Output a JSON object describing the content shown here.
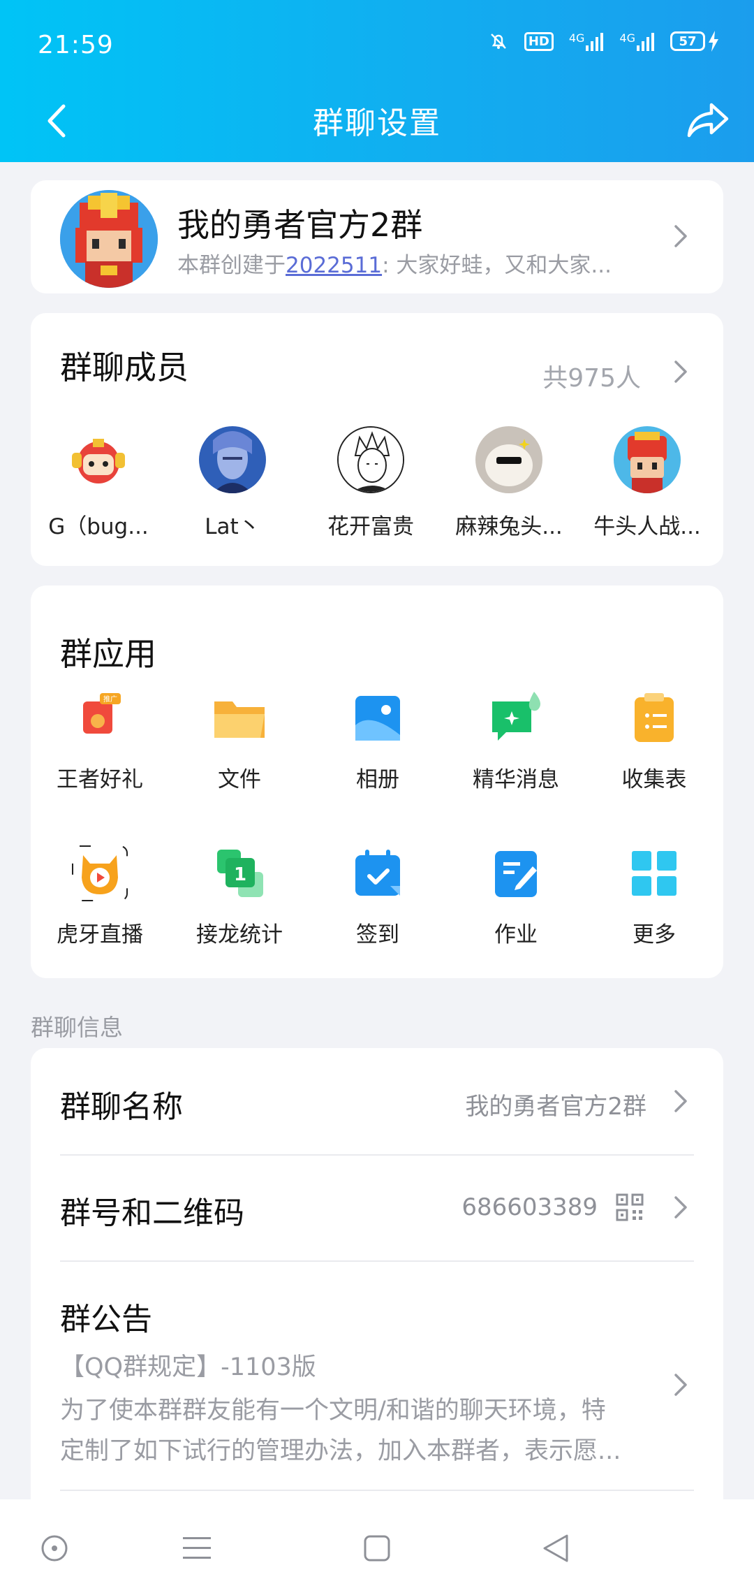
{
  "status_bar": {
    "time": "21:59",
    "hd_label": "HD",
    "net1": "4G",
    "net2": "4G",
    "battery": "57"
  },
  "nav": {
    "title": "群聊设置",
    "back_icon": "back-chevron-icon",
    "share_icon": "share-icon"
  },
  "group": {
    "name": "我的勇者官方2群",
    "desc_prefix": "本群创建于",
    "desc_link": "2022511",
    "desc_suffix": ": 大家好蛙，又和大家..."
  },
  "members": {
    "title": "群聊成员",
    "count": "共975人",
    "list": [
      {
        "name": "G（bug..."
      },
      {
        "name": "Lat丶"
      },
      {
        "name": "花开富贵"
      },
      {
        "name": "麻辣兔头..."
      },
      {
        "name": "牛头人战..."
      }
    ]
  },
  "apps": {
    "title": "群应用",
    "items": [
      {
        "label": "王者好礼",
        "icon": "gift-icon"
      },
      {
        "label": "文件",
        "icon": "folder-icon"
      },
      {
        "label": "相册",
        "icon": "album-icon"
      },
      {
        "label": "精华消息",
        "icon": "essence-message-icon"
      },
      {
        "label": "收集表",
        "icon": "form-icon"
      },
      {
        "label": "虎牙直播",
        "icon": "huya-live-icon"
      },
      {
        "label": "接龙统计",
        "icon": "relay-stats-icon"
      },
      {
        "label": "签到",
        "icon": "checkin-icon"
      },
      {
        "label": "作业",
        "icon": "homework-icon"
      },
      {
        "label": "更多",
        "icon": "more-grid-icon"
      }
    ],
    "gift_badge": "推广"
  },
  "info": {
    "section_label": "群聊信息",
    "name_row": {
      "title": "群聊名称",
      "value": "我的勇者官方2群"
    },
    "id_row": {
      "title": "群号和二维码",
      "value": "686603389"
    },
    "notice_row": {
      "title": "群公告",
      "heading": "【QQ群规定】-1103版",
      "line1": "为了使本群群友能有一个文明/和谐的聊天环境，特",
      "line2": "定制了如下试行的管理办法，加入本群者，表示愿..."
    }
  },
  "colors": {
    "header_start": "#00c4f6",
    "header_end": "#1b9ded",
    "link": "#5a6cd6"
  }
}
